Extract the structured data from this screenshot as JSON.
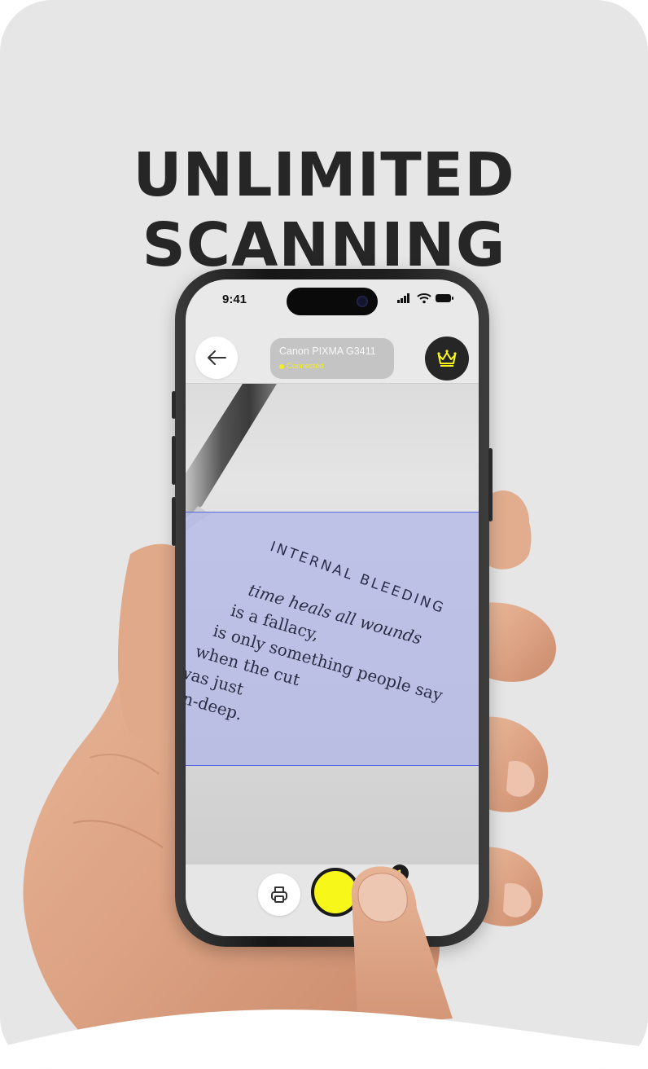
{
  "headline": {
    "line1": "UNLIMITED",
    "line2": "SCANNING"
  },
  "status_bar": {
    "time": "9:41"
  },
  "top_bar": {
    "back_icon": "arrow-left-icon",
    "printer_name": "Canon PIXMA G3411",
    "printer_status": "Connected",
    "premium_icon": "crown-icon"
  },
  "document": {
    "title": "INTERNAL BLEEDING",
    "lines": [
      "time heals all wounds",
      "is a fallacy,",
      "is only something people say",
      "when the cut",
      "was just",
      "skin-deep."
    ]
  },
  "bottom_bar": {
    "print_icon": "printer-icon",
    "gallery_count": "1"
  },
  "colors": {
    "accent": "#f7f71a",
    "scan_overlay": "#b0b6e8",
    "dark": "#262626"
  }
}
